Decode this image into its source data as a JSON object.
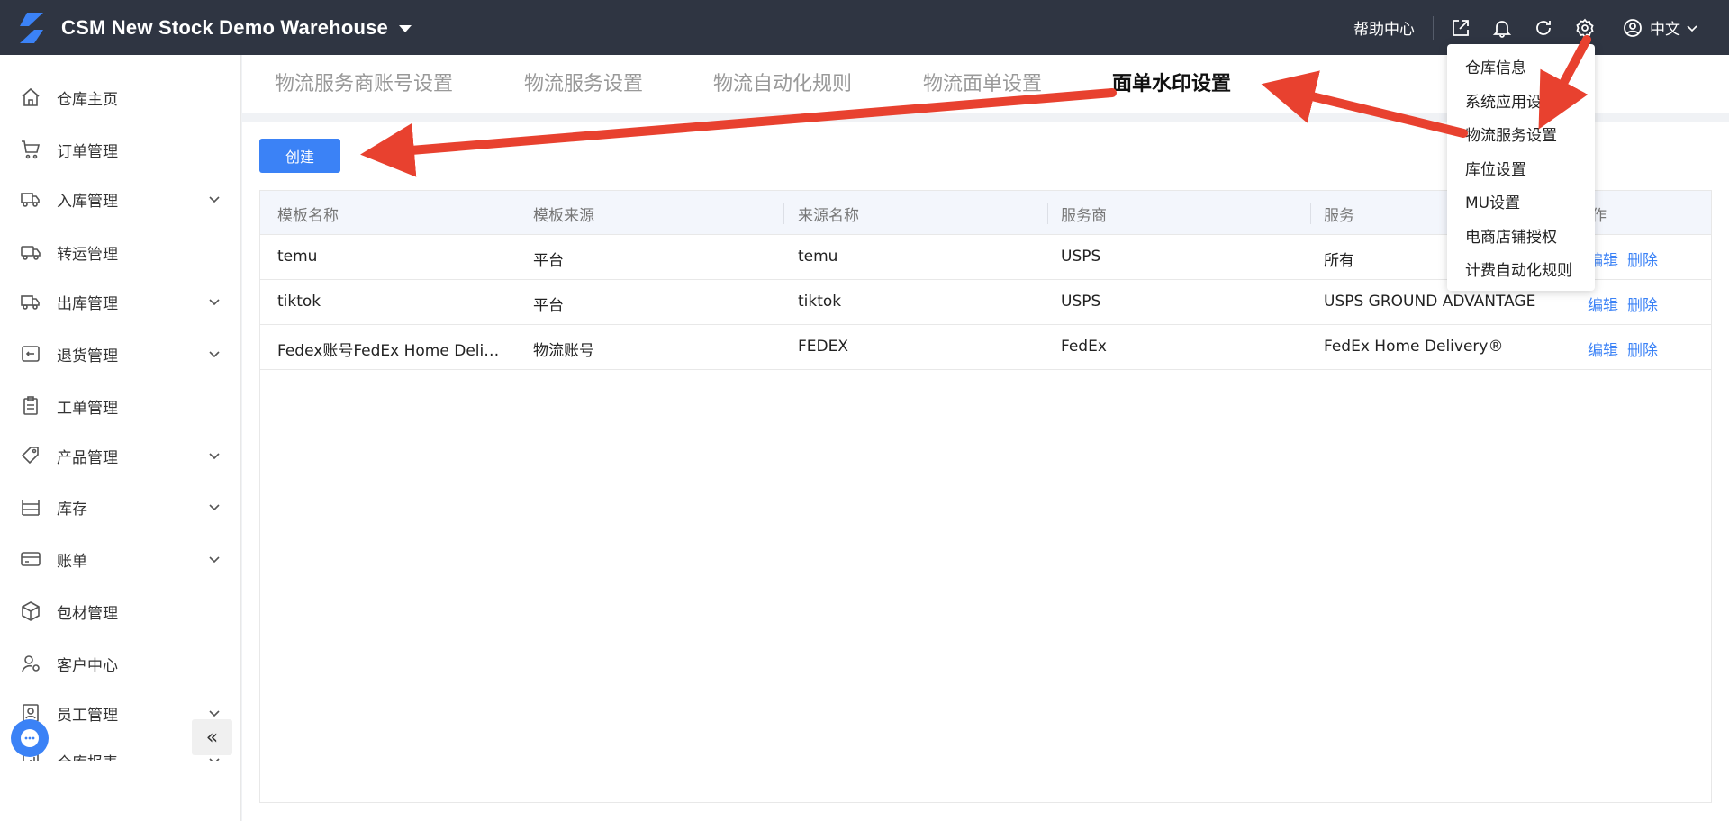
{
  "header": {
    "warehouse_name": "CSM New Stock Demo Warehouse",
    "help_label": "帮助中心",
    "language": "中文",
    "icons": [
      "export-icon",
      "bell-icon",
      "refresh-icon",
      "gear-icon",
      "user-icon"
    ]
  },
  "sidebar": {
    "items": [
      {
        "label": "仓库主页",
        "icon": "home-icon",
        "expandable": false
      },
      {
        "label": "订单管理",
        "icon": "cart-icon",
        "expandable": false
      },
      {
        "label": "入库管理",
        "icon": "truck-in-icon",
        "expandable": true
      },
      {
        "label": "转运管理",
        "icon": "truck-icon",
        "expandable": false
      },
      {
        "label": "出库管理",
        "icon": "truck-out-icon",
        "expandable": true
      },
      {
        "label": "退货管理",
        "icon": "return-icon",
        "expandable": true
      },
      {
        "label": "工单管理",
        "icon": "clipboard-icon",
        "expandable": false
      },
      {
        "label": "产品管理",
        "icon": "tag-icon",
        "expandable": true
      },
      {
        "label": "库存",
        "icon": "shelf-icon",
        "expandable": true
      },
      {
        "label": "账单",
        "icon": "card-icon",
        "expandable": true
      },
      {
        "label": "包材管理",
        "icon": "box-icon",
        "expandable": false
      },
      {
        "label": "客户中心",
        "icon": "customer-icon",
        "expandable": false
      },
      {
        "label": "员工管理",
        "icon": "staff-icon",
        "expandable": true
      },
      {
        "label": "仓库报表",
        "icon": "report-icon",
        "expandable": true
      }
    ],
    "chat_icon": "chat-icon",
    "collapse_label": "«"
  },
  "tabs": [
    {
      "label": "物流服务商账号设置",
      "active": false
    },
    {
      "label": "物流服务设置",
      "active": false
    },
    {
      "label": "物流自动化规则",
      "active": false
    },
    {
      "label": "物流面单设置",
      "active": false
    },
    {
      "label": "面单水印设置",
      "active": true
    }
  ],
  "main": {
    "create_label": "创建",
    "table": {
      "columns": [
        "模板名称",
        "模板来源",
        "来源名称",
        "服务商",
        "服务",
        "操作"
      ],
      "rows": [
        {
          "name": "temu",
          "source": "平台",
          "source_name": "temu",
          "carrier": "USPS",
          "service": "所有",
          "edit": "编辑",
          "delete": "删除"
        },
        {
          "name": "tiktok",
          "source": "平台",
          "source_name": "tiktok",
          "carrier": "USPS",
          "service": "USPS GROUND ADVANTAGE",
          "edit": "编辑",
          "delete": "删除"
        },
        {
          "name": "Fedex账号FedEx Home Delivery®",
          "source": "物流账号",
          "source_name": "FEDEX",
          "carrier": "FedEx",
          "service": "FedEx Home Delivery®",
          "edit": "编辑",
          "delete": "删除"
        }
      ]
    }
  },
  "settings_menu": {
    "items": [
      "仓库信息",
      "系统应用设置",
      "物流服务设置",
      "库位设置",
      "MU设置",
      "电商店铺授权",
      "计费自动化规则"
    ]
  },
  "colors": {
    "topbar": "#2f3542",
    "accent": "#3b82f6",
    "arrow": "#e8412f"
  }
}
